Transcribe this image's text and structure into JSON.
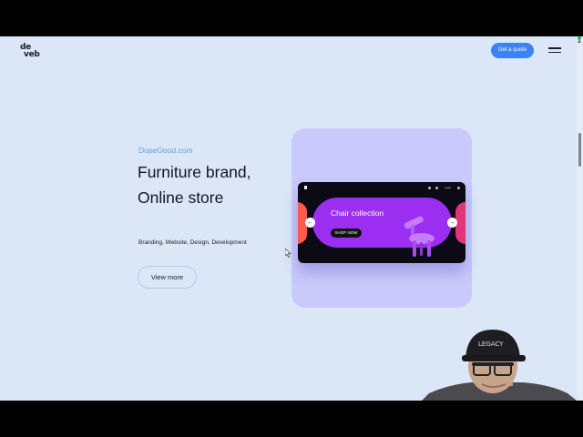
{
  "header": {
    "logo_line1": "de",
    "logo_line2": "veb",
    "quote_button": "Get a quote",
    "menu_icon": "hamburger-icon"
  },
  "hero": {
    "subtitle": "DopeGood.com",
    "title": "Furniture brand, Online store",
    "services": "Branding, Website, Design, Development",
    "cta": "View more"
  },
  "showcase": {
    "banner_title": "Chair collection",
    "banner_button": "SHOP NOW",
    "nav_prev": "←",
    "nav_next": "→",
    "mock_login": "Login",
    "accent": "#9b2ef0",
    "left_accent": "#ff5a4e",
    "right_accent": "#e1357a",
    "card_bg": "#c9c9fb"
  },
  "webcam": {
    "cap_text": "LEGACY"
  },
  "colors": {
    "page_bg": "#dbe7f7",
    "primary": "#3b82f6",
    "link": "#6a9fd3"
  }
}
